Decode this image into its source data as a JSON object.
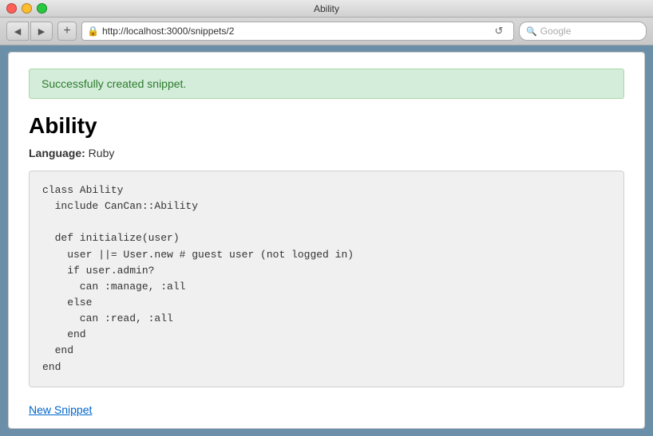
{
  "window": {
    "title": "Ability"
  },
  "browser": {
    "url": "http://localhost:3000/snippets/2",
    "search_placeholder": "Google",
    "nav_back_label": "◀",
    "nav_forward_label": "▶",
    "add_tab_label": "+",
    "reload_label": "↺"
  },
  "page": {
    "flash_message": "Successfully created snippet.",
    "snippet_title": "Ability",
    "language_label": "Language:",
    "language_value": "Ruby",
    "code": "class Ability\n  include CanCan::Ability\n\n  def initialize(user)\n    user ||= User.new # guest user (not logged in)\n    if user.admin?\n      can :manage, :all\n    else\n      can :read, :all\n    end\n  end\nend",
    "new_snippet_label": "New Snippet"
  }
}
